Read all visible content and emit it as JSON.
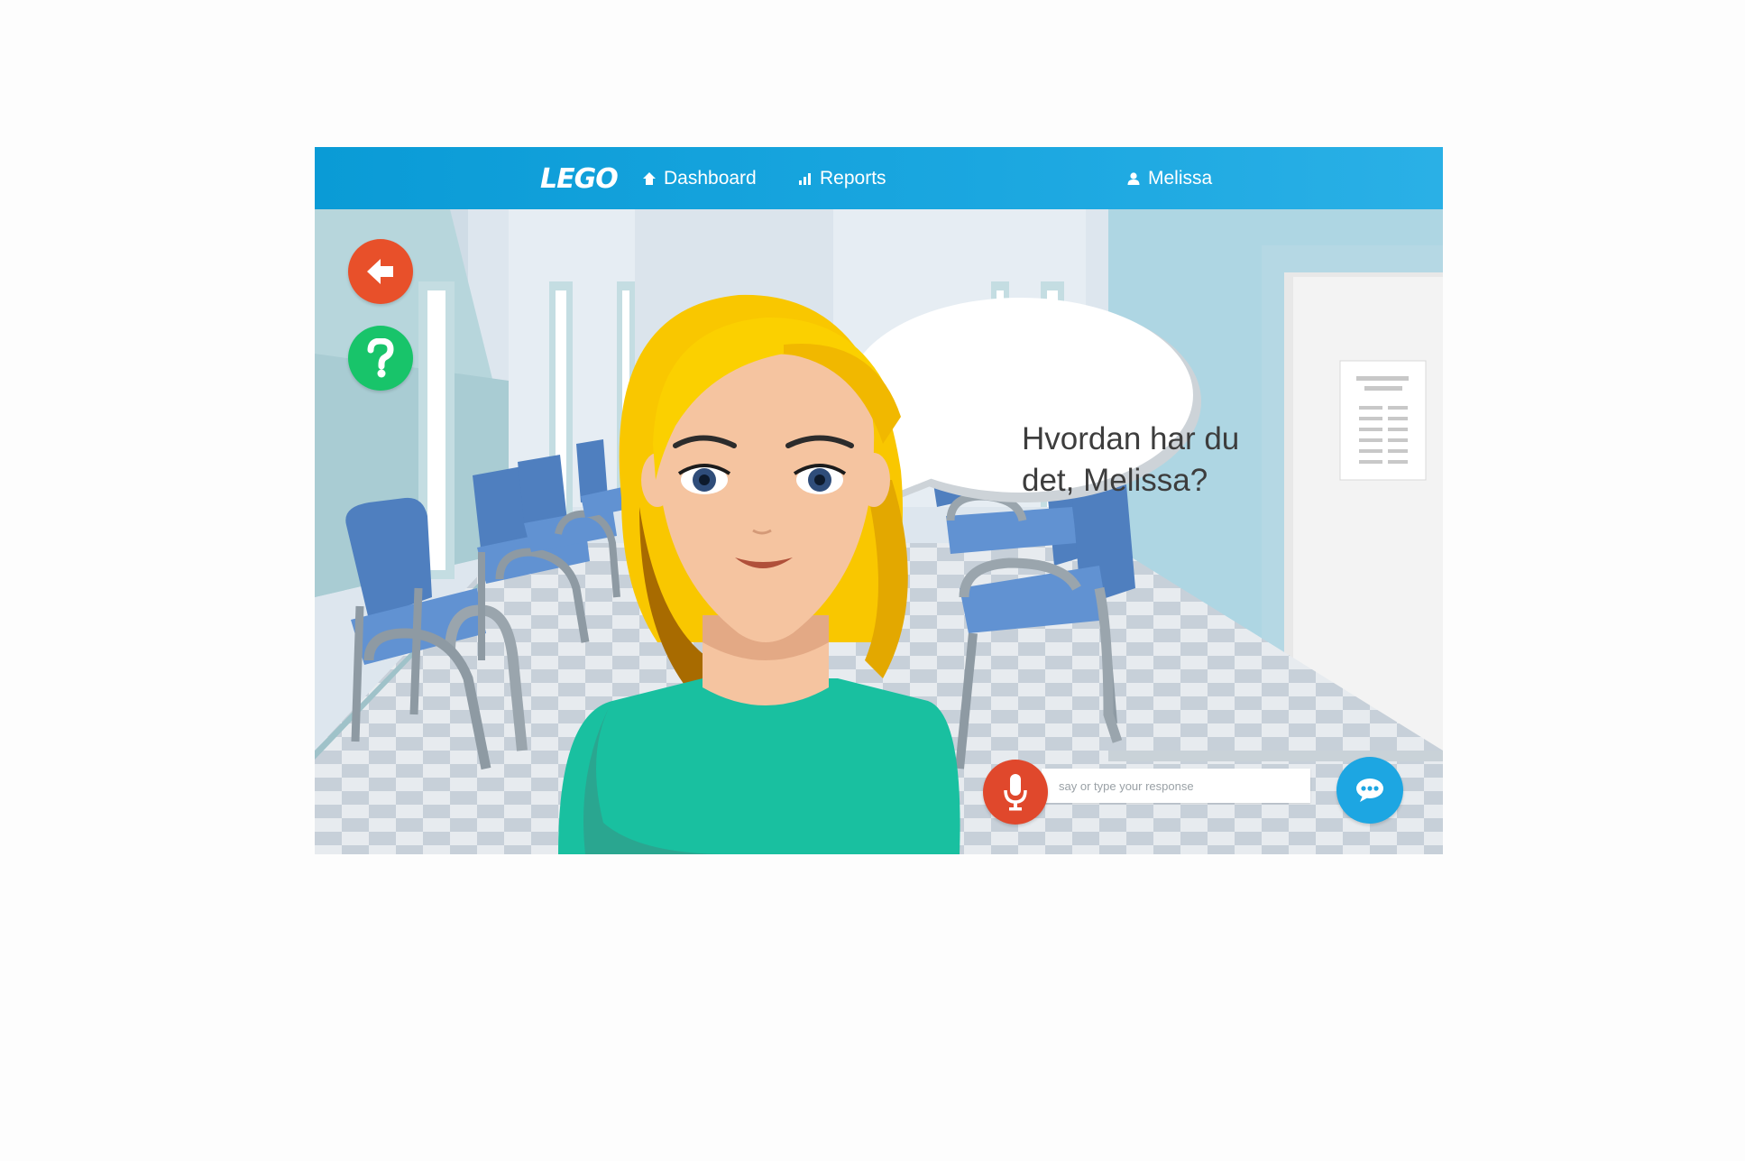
{
  "navbar": {
    "logo_text": "LEGO",
    "dashboard_label": "Dashboard",
    "reports_label": "Reports",
    "user_name": "Melissa",
    "background": "#1ba7e0"
  },
  "scene": {
    "speech_bubble_text": "Hvordan har du det, Melissa?"
  },
  "controls": {
    "back_icon": "arrow-left-icon",
    "help_icon": "question-mark-icon",
    "mic_icon": "microphone-icon",
    "send_icon": "chat-bubble-icon",
    "response_placeholder": "say or type your response",
    "response_value": ""
  },
  "colors": {
    "back_button": "#e8502a",
    "help_button": "#18c46a",
    "mic_button": "#e0482c",
    "send_button": "#1da6e2"
  }
}
